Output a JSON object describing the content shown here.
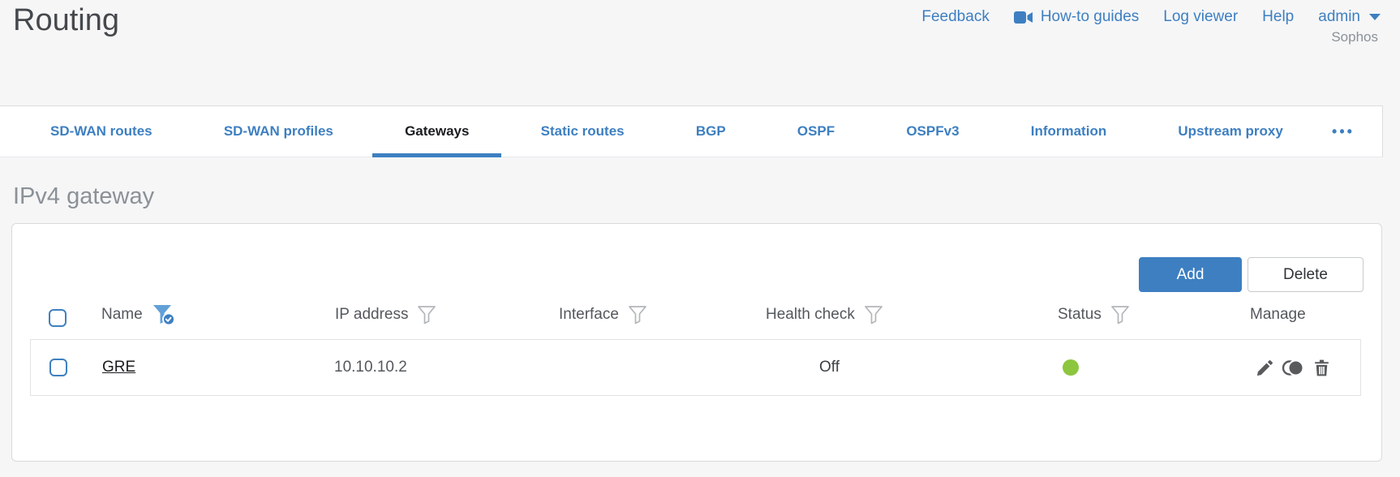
{
  "page": {
    "title": "Routing"
  },
  "brand": "Sophos",
  "top_nav": {
    "feedback": "Feedback",
    "how_to_guides": "How-to guides",
    "log_viewer": "Log viewer",
    "help": "Help",
    "user_menu": "admin"
  },
  "tabs": {
    "items": [
      {
        "label": "SD-WAN routes",
        "active": false
      },
      {
        "label": "SD-WAN profiles",
        "active": false
      },
      {
        "label": "Gateways",
        "active": true
      },
      {
        "label": "Static routes",
        "active": false
      },
      {
        "label": "BGP",
        "active": false
      },
      {
        "label": "OSPF",
        "active": false
      },
      {
        "label": "OSPFv3",
        "active": false
      },
      {
        "label": "Information",
        "active": false
      },
      {
        "label": "Upstream proxy",
        "active": false
      }
    ],
    "overflow": "•••"
  },
  "section_heading": "IPv4 gateway",
  "toolbar": {
    "add": "Add",
    "delete": "Delete"
  },
  "table": {
    "columns": [
      {
        "label": "Name",
        "filter": "active"
      },
      {
        "label": "IP address",
        "filter": "default"
      },
      {
        "label": "Interface",
        "filter": "default"
      },
      {
        "label": "Health check",
        "filter": "default"
      },
      {
        "label": "Status",
        "filter": "default"
      },
      {
        "label": "Manage",
        "filter": "none"
      }
    ],
    "rows": [
      {
        "name": "GRE",
        "ip_address": "10.10.10.2",
        "interface": "",
        "health_check": "Off",
        "status": "up"
      }
    ]
  },
  "icons": {
    "manage": [
      "edit-pencil",
      "clone",
      "delete-trash"
    ],
    "name_filter": "filter-funnel-checked",
    "column_filter": "filter-funnel"
  },
  "colors": {
    "accent_blue": "#3d7fc1",
    "status_green": "#8cc63e",
    "heading_gray": "#8b9197",
    "text_dark": "#45484c"
  }
}
